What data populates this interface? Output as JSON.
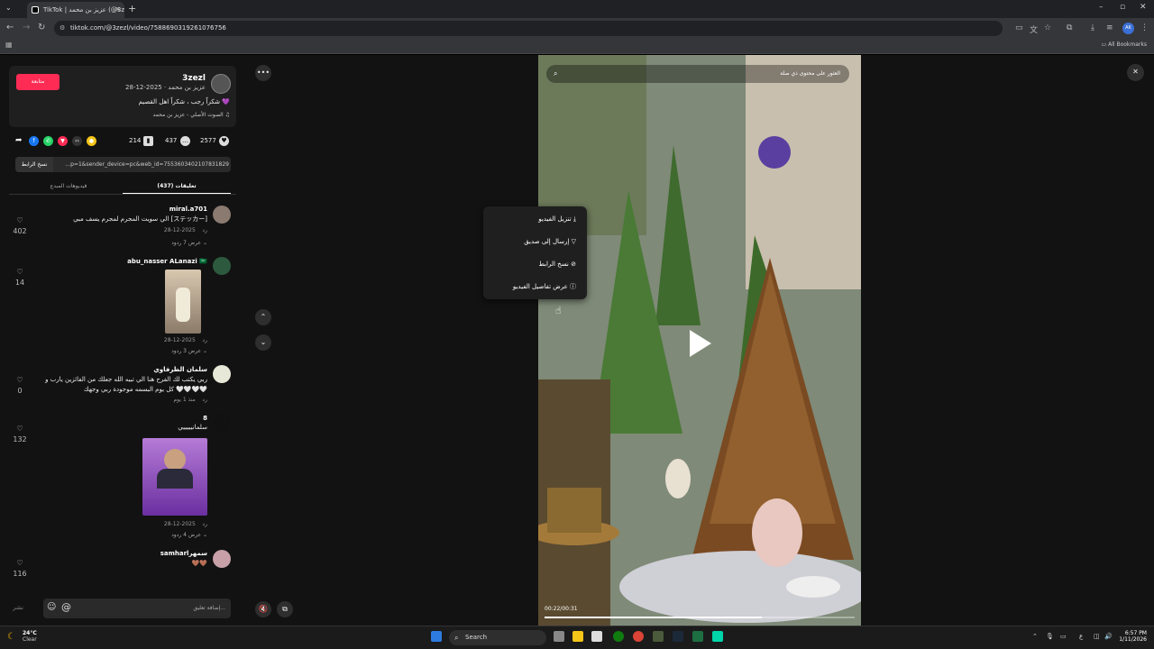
{
  "browser": {
    "tab_title": "TikTok | عزيز بن محمد (@3zezl)",
    "url": "tiktok.com/@3zezl/video/7588690319261076756",
    "all_bookmarks": "All Bookmarks",
    "profile_initials": "AK"
  },
  "post": {
    "follow_label": "متابعة",
    "handle": "3zezl",
    "display_name_date": "عزيز بن محمد · 2025-12-28",
    "caption": "شكراً رجب ، شكراً اهل القصيم 💜",
    "music": "الصوت الأصلي - عزيز بن محمد",
    "likes": "2577",
    "comments": "437",
    "saves": "214",
    "copy_link_label": "نسخ الرابط",
    "link_text": "...p=1&sender_device=pc&web_id=7553603402107831829"
  },
  "tabs": {
    "comments": "تعليقات (437)",
    "creator_videos": "فيديوهات المبدع"
  },
  "comments": [
    {
      "name": "miral.a701",
      "text": "الي سويت المجرم لمجرم يسف مبي [ステッカー]",
      "date": "2025-12-28",
      "reply": "رد",
      "replies": "عرض 7 ردود",
      "likes": "402"
    },
    {
      "name": "abu_nasser ALanazi 🇸🇦",
      "text": "",
      "date": "2025-12-28",
      "reply": "رد",
      "replies": "عرض 3 ردود",
      "likes": "14"
    },
    {
      "name": "سلمان الظرفاوي",
      "text": "ربي يكتب لك الفرح هنا الي تبيه الله جعلك من الفائزين يارب و كل يوم البسمه موجودة ربي وجهك 🤍🤍🤍🤍",
      "date": "منذ 1 يوم",
      "reply": "رد",
      "replies": "",
      "likes": "0"
    },
    {
      "name": "8",
      "text": "سلمانيييييي",
      "date": "2025-12-28",
      "reply": "رد",
      "replies": "عرض 4 ردود",
      "likes": "132"
    },
    {
      "name": "samharlسمهر",
      "text": "🤎🤎",
      "date": "",
      "reply": "",
      "replies": "",
      "likes": "116"
    }
  ],
  "comment_input": {
    "post_label": "نشر",
    "placeholder": "إضافة تعليق..."
  },
  "video": {
    "search_placeholder": "العثور على محتوى ذي صلة",
    "timecode": "00:22/00:31",
    "progress_fraction": 0.7
  },
  "context_menu": [
    {
      "label": "تنزيل الفيديو",
      "icon": "download-icon"
    },
    {
      "label": "إرسال إلى صديق",
      "icon": "send-icon"
    },
    {
      "label": "نسخ الرابط",
      "icon": "link-icon"
    },
    {
      "label": "عرض تفاصيل الفيديو",
      "icon": "info-icon"
    }
  ],
  "taskbar": {
    "temp": "24°C",
    "condition": "Clear",
    "search": "Search",
    "time": "6:57 PM",
    "date": "1/11/2026"
  },
  "colors": {
    "accent": "#fe2c55",
    "background": "#121212"
  }
}
